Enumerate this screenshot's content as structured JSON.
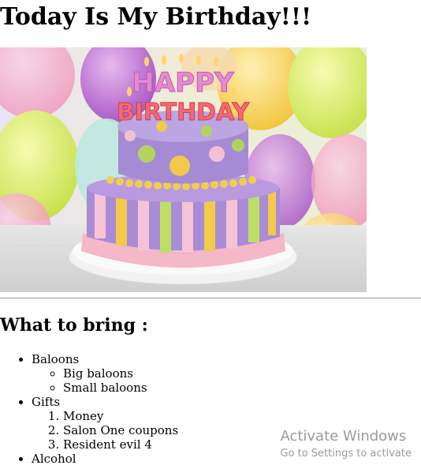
{
  "heading": "Today Is My Birthday!!!",
  "hero_image": {
    "alt": "birthday cake",
    "topper_line1": "HAPPY",
    "topper_line2": "BIRTHDAY"
  },
  "section_title": "What to bring :",
  "list": {
    "item1": {
      "label": "Baloons",
      "children": [
        "Big baloons",
        "Small baloons"
      ]
    },
    "item2": {
      "label": "Gifts",
      "children": [
        "Money",
        "Salon One coupons",
        "Resident evil 4"
      ]
    },
    "item3": {
      "label": "Alcohol"
    }
  },
  "watermark": {
    "title": "Activate Windows",
    "subtitle": "Go to Settings to activate"
  }
}
